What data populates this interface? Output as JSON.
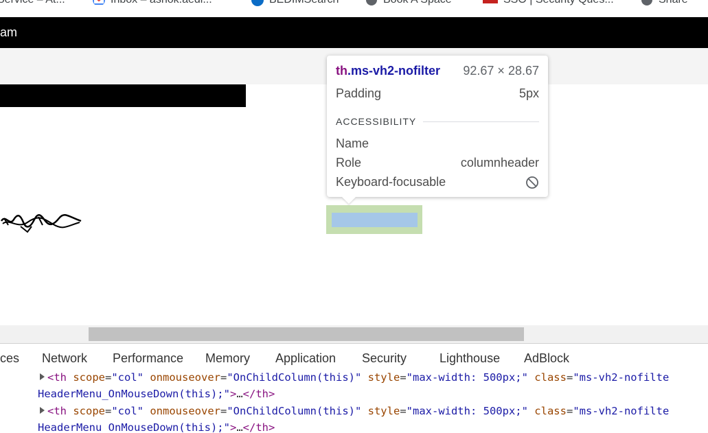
{
  "bookmarks": [
    {
      "label": "Service – At...",
      "icon": "globe-icon",
      "color": "#5f6368"
    },
    {
      "label": "Inbox – ashok.aedi...",
      "icon": "gmail-icon",
      "color": "#4285f4"
    },
    {
      "label": "BEDIMSearch",
      "icon": "sharepoint-icon",
      "color": "#0b6cc6"
    },
    {
      "label": "Book A Space",
      "icon": "globe-icon",
      "color": "#5f6368"
    },
    {
      "label": "SSO | Security Ques...",
      "icon": "red-logo-icon",
      "color": "#c5221f"
    },
    {
      "label": "Share",
      "icon": "globe-icon",
      "color": "#5f6368"
    }
  ],
  "header": {
    "title": "am"
  },
  "tooltip": {
    "tag": "th",
    "class_name": ".ms-vh2-nofilter",
    "dimensions": "92.67 × 28.67",
    "padding_label": "Padding",
    "padding_value": "5px",
    "section_label": "ACCESSIBILITY",
    "name_label": "Name",
    "name_value": "",
    "role_label": "Role",
    "role_value": "columnheader",
    "keyboard_label": "Keyboard-focusable",
    "keyboard_icon": "not-allowed-icon"
  },
  "devtools": {
    "tabs": [
      "ces",
      "Network",
      "Performance",
      "Memory",
      "Application",
      "Security",
      "Lighthouse",
      "AdBlock"
    ],
    "code_lines": [
      {
        "tag_open": "<th",
        "attr1": " scope",
        "eq1": "=",
        "val1": "\"col\"",
        "attr2": " onmouseover",
        "eq2": "=",
        "val2": "\"OnChildColumn(this)\"",
        "attr3": " style",
        "eq3": "=",
        "val3": "\"max-width: 500px;\"",
        "attr4": " class",
        "eq4": "=",
        "val4": "\"ms-vh2-nofilte",
        "continuation": "HeaderMenu_OnMouseDown(this);\"",
        "tail_open": ">",
        "ellipsis": "…",
        "tag_close": "</th>"
      },
      {
        "tag_open": "<th",
        "attr1": " scope",
        "eq1": "=",
        "val1": "\"col\"",
        "attr2": " onmouseover",
        "eq2": "=",
        "val2": "\"OnChildColumn(this)\"",
        "attr3": " style",
        "eq3": "=",
        "val3": "\"max-width: 500px;\"",
        "attr4": " class",
        "eq4": "=",
        "val4": "\"ms-vh2-nofilte",
        "continuation": "HeaderMenu_OnMouseDown(this);\"",
        "tail_open": ">",
        "ellipsis": "…",
        "tag_close": "</th>"
      }
    ]
  },
  "colors": {
    "highlight_margin": "#c5deb0",
    "highlight_content": "#a5c7e8",
    "tag_color": "#881280",
    "attr_color": "#994500",
    "value_color": "#1a1aa6"
  }
}
